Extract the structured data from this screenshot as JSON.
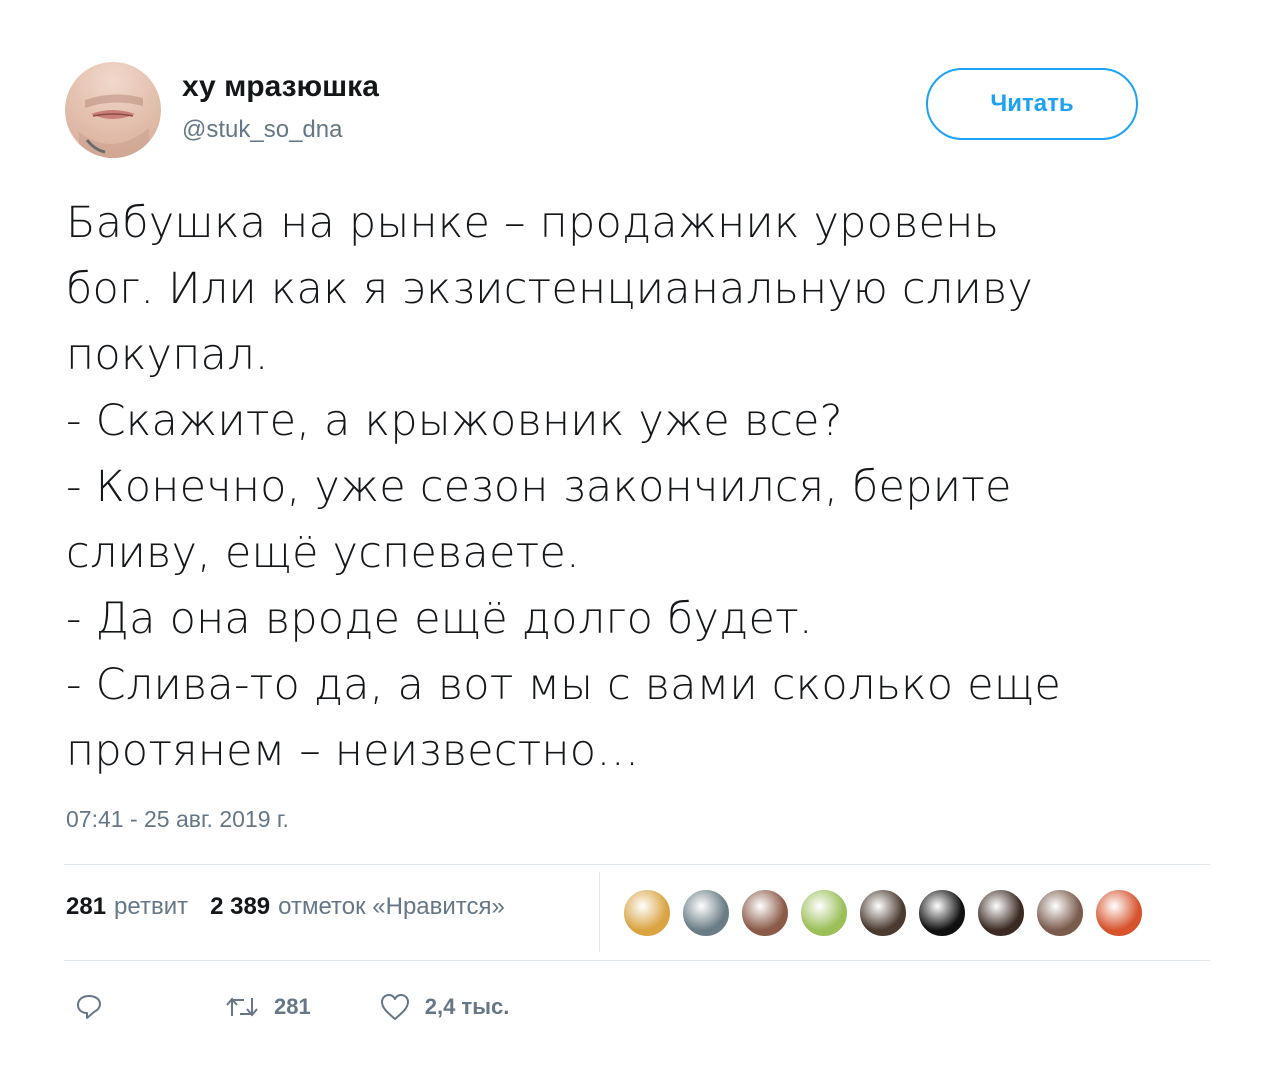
{
  "author": {
    "display_name": "ху мразюшка",
    "handle": "@stuk_so_dna"
  },
  "follow_button": {
    "label": "Читать"
  },
  "tweet": {
    "text": "Бабушка на рынке – продажник уровень\nбог. Или как я экзистенцианальную сливу\nпокупал.\n- Скажите, а крыжовник уже все?\n- Конечно, уже сезон закончился, берите\nсливу, ещё успеваете.\n- Да она вроде ещё долго будет.\n- Слива-то да, а вот мы с вами сколько еще\nпротянем – неизвестно…",
    "timestamp": "07:41 - 25 авг. 2019 г."
  },
  "stats": {
    "retweets_count": "281",
    "retweets_label": "ретвит",
    "likes_count": "2 389",
    "likes_label": "отметок «Нравится»"
  },
  "likers": [
    {
      "name": "liker-1",
      "color": "#d9a441"
    },
    {
      "name": "liker-2",
      "color": "#6a7d86"
    },
    {
      "name": "liker-3",
      "color": "#8b5a48"
    },
    {
      "name": "liker-4",
      "color": "#9bbf59"
    },
    {
      "name": "liker-5",
      "color": "#4a3a30"
    },
    {
      "name": "liker-6",
      "color": "#111111"
    },
    {
      "name": "liker-7",
      "color": "#3b2a22"
    },
    {
      "name": "liker-8",
      "color": "#7a5b4c"
    },
    {
      "name": "liker-9",
      "color": "#d6532c"
    }
  ],
  "actions": {
    "retweet_count": "281",
    "like_count": "2,4 тыс."
  },
  "colors": {
    "accent": "#1da1f2",
    "muted": "#657786",
    "divider": "#e1e8ed"
  }
}
